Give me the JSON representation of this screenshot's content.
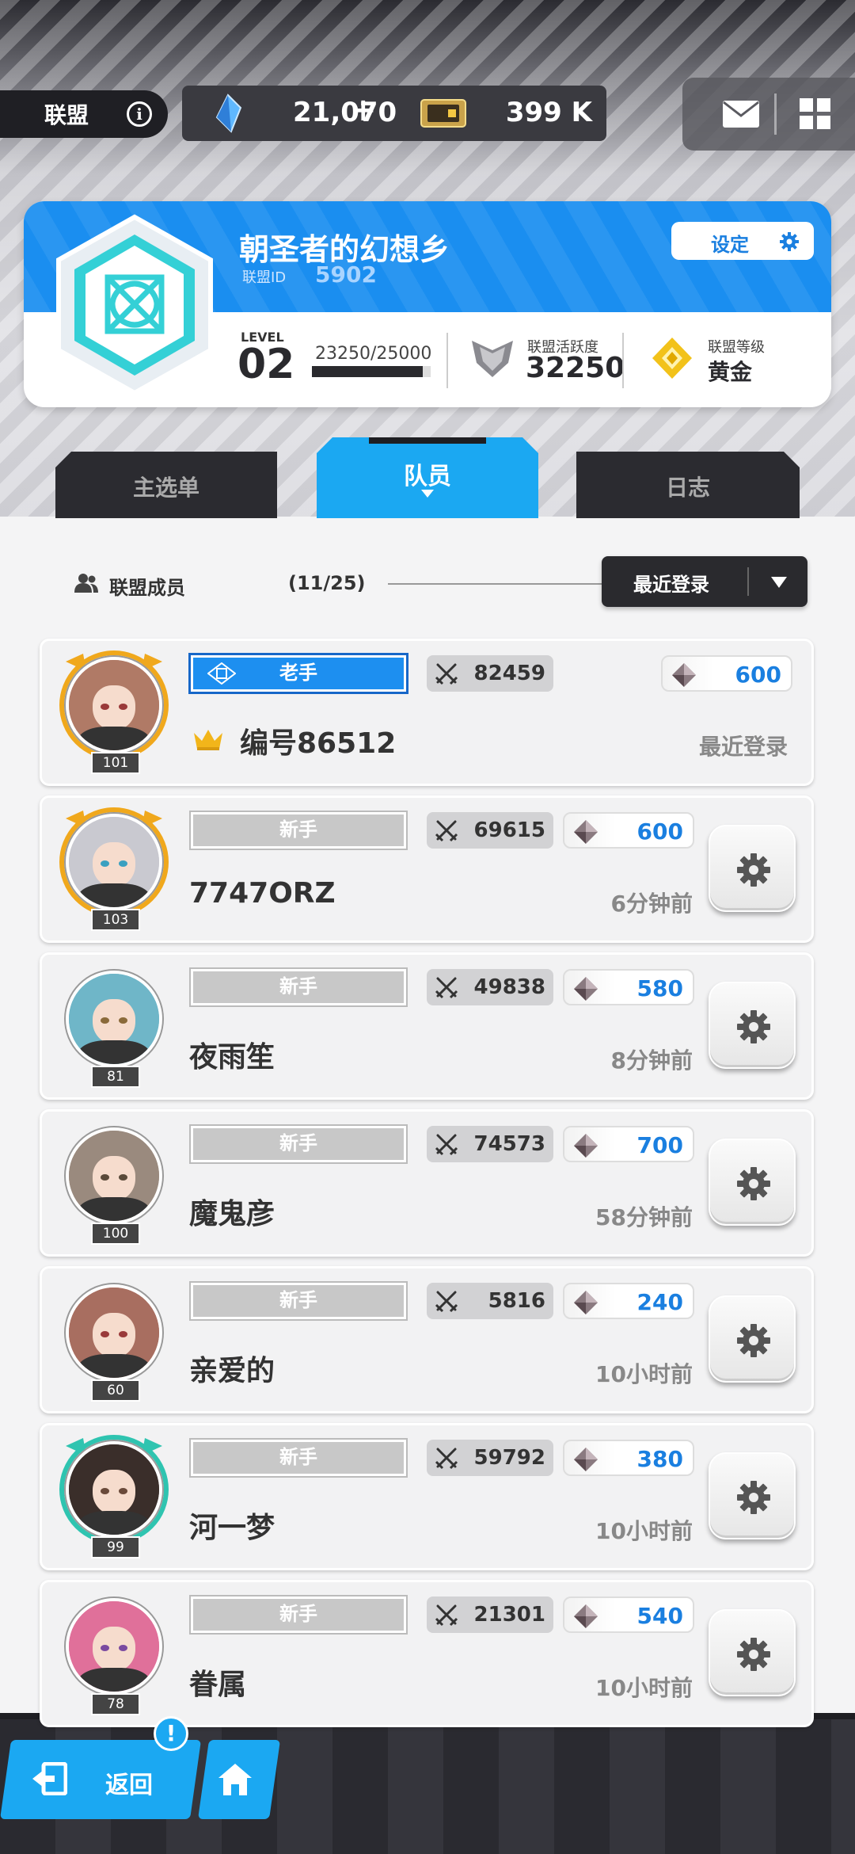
{
  "topbar": {
    "alliance_label": "联盟",
    "crystals": "21,070",
    "plus": "+",
    "tickets": "399 K"
  },
  "alliance": {
    "name": "朝圣者的幻想乡",
    "id_label": "联盟ID",
    "id": "5902",
    "settings_label": "设定",
    "level_label": "LEVEL",
    "level": "02",
    "exp_text": "23250/25000",
    "exp_fraction": 0.93,
    "activity_label": "联盟活跃度",
    "activity_value": "32250",
    "rank_label": "联盟等级",
    "rank_value": "黄金"
  },
  "tabs": {
    "main": "主选单",
    "members": "队员",
    "log": "日志"
  },
  "members_header": {
    "label": "联盟成员",
    "count": "(11/25)",
    "sort_label": "最近登录"
  },
  "members": [
    {
      "role": "老手",
      "level": "101",
      "power": "82459",
      "gems": "600",
      "name": "编号86512",
      "time": "最近登录",
      "leader": true,
      "hair": "#b07a66",
      "eye": "#9a3a3a"
    },
    {
      "role": "新手",
      "level": "103",
      "power": "69615",
      "gems": "600",
      "name": "7747ORZ",
      "time": "6分钟前",
      "leader": false,
      "hair": "#c9c9d0",
      "eye": "#3aa0c0"
    },
    {
      "role": "新手",
      "level": "81",
      "power": "49838",
      "gems": "580",
      "name": "夜雨笙",
      "time": "8分钟前",
      "leader": false,
      "hair": "#6fb6c8",
      "eye": "#8a6a3a"
    },
    {
      "role": "新手",
      "level": "100",
      "power": "74573",
      "gems": "700",
      "name": "魔鬼彦",
      "time": "58分钟前",
      "leader": false,
      "hair": "#9a8a7e",
      "eye": "#5a4a3a"
    },
    {
      "role": "新手",
      "level": "60",
      "power": "5816",
      "gems": "240",
      "name": "亲爱的",
      "time": "10小时前",
      "leader": false,
      "hair": "#a86e60",
      "eye": "#9a3a3a"
    },
    {
      "role": "新手",
      "level": "99",
      "power": "59792",
      "gems": "380",
      "name": "河一梦",
      "time": "10小时前",
      "leader": false,
      "hair": "#3a2e2a",
      "eye": "#6a4a3a"
    },
    {
      "role": "新手",
      "level": "78",
      "power": "21301",
      "gems": "540",
      "name": "眷属",
      "time": "10小时前",
      "leader": false,
      "hair": "#e0709a",
      "eye": "#7a4aa0"
    }
  ],
  "bottom": {
    "back_label": "返回",
    "alert": "!"
  },
  "colors": {
    "accent_blue": "#1ba8f2",
    "card_blue": "#1a8ef0",
    "gem_value": "#1a7fe0"
  }
}
